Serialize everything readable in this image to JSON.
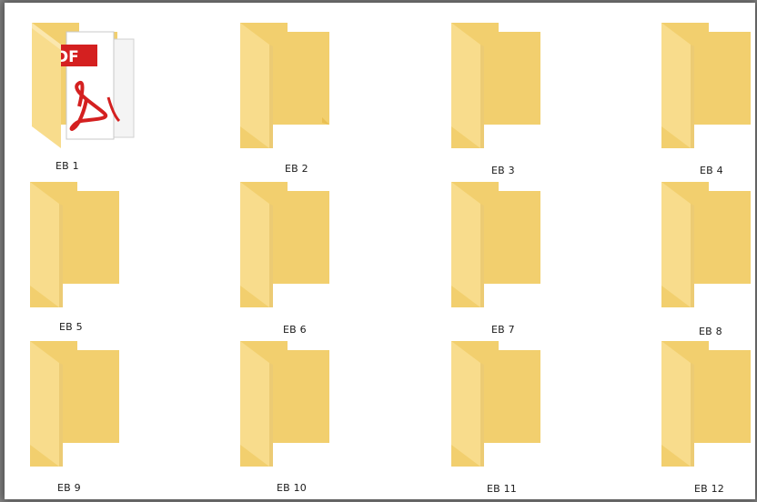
{
  "folders": [
    {
      "name": "EB 1",
      "icon": "pdf-folder-icon"
    },
    {
      "name": "EB 2",
      "icon": "folder-icon"
    },
    {
      "name": "EB 3",
      "icon": "folder-icon"
    },
    {
      "name": "EB 4",
      "icon": "folder-icon"
    },
    {
      "name": "EB 5",
      "icon": "folder-icon"
    },
    {
      "name": "EB 6",
      "icon": "folder-icon"
    },
    {
      "name": "EB 7",
      "icon": "folder-icon"
    },
    {
      "name": "EB 8",
      "icon": "folder-icon"
    },
    {
      "name": "EB 9",
      "icon": "folder-icon"
    },
    {
      "name": "EB 10",
      "icon": "folder-icon"
    },
    {
      "name": "EB 11",
      "icon": "folder-icon"
    },
    {
      "name": "EB 12",
      "icon": "folder-icon"
    }
  ],
  "pdf_overlay_text": "DF",
  "colors": {
    "folder_back": "#f2cf6e",
    "folder_front": "#f8dc8c",
    "folder_fold": "#e9bf52",
    "pdf_red": "#d42020"
  }
}
